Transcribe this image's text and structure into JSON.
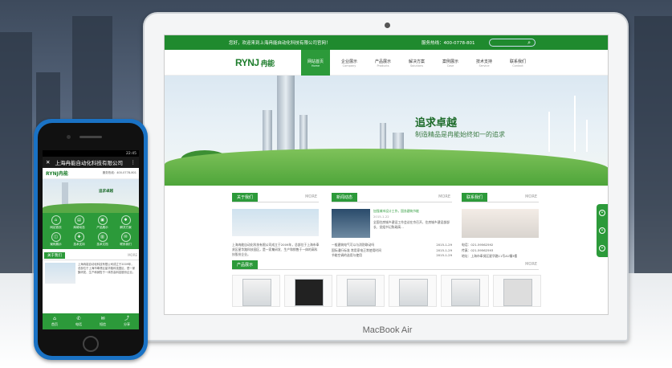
{
  "laptop_brand": "MacBook Air",
  "site": {
    "welcome": "您好，欢迎来到上海冉能自动化科技有限公司官网！",
    "hotline": "服务热线：400-0778-801",
    "logo_text": "RYNJ",
    "logo_cn": "冉能",
    "nav": [
      {
        "cn": "网站首页",
        "en": "Home",
        "active": true
      },
      {
        "cn": "企业展示",
        "en": "Company"
      },
      {
        "cn": "产品展示",
        "en": "Products"
      },
      {
        "cn": "解决方案",
        "en": "Solutions"
      },
      {
        "cn": "案例展示",
        "en": "Case"
      },
      {
        "cn": "技术支持",
        "en": "Service"
      },
      {
        "cn": "联系我们",
        "en": "Contact"
      }
    ],
    "slogan_main": "追求卓越",
    "slogan_sub": "制造精品是冉能始终如一的追求",
    "about": {
      "title": "关于我们",
      "more": "MORE",
      "text": "上海冉能自动化科技有限公司成立于2009年，总部位于上海市奉贤区星华路科技园区，是一家集研发、生产和销售于一体的高科技股份企业。"
    },
    "news": {
      "title": "新闻动态",
      "more": "MORE",
      "headline": "加强城市设计工作，国务建筑节能",
      "headline_date": "2015-1-22",
      "summary": "全国住房城乡建设工作会议在京召开，住房城乡建设部部长、党组书记陈政高…",
      "items": [
        {
          "text": "一般建筑电气可以与消防联动吗",
          "date": "2015-1-29"
        },
        {
          "text": "国际通行标准 常用家电正常使用时间",
          "date": "2015-1-29"
        },
        {
          "text": "节能空调的选用与使用",
          "date": "2015-1-29"
        }
      ]
    },
    "contact": {
      "title": "联系我们",
      "more": "MORE",
      "tel": "电话：021-59562592",
      "fax": "传真：021-59562593",
      "addr": "地址：上海市奉贤区星华路11号A1幢3楼"
    },
    "products": {
      "title": "产品展示",
      "more": "MORE"
    }
  },
  "mobile": {
    "time": "22:45",
    "title": "上海冉能自动化科技有限公司",
    "logo": "RYNJ冉能",
    "hotline": "服务热线：400-0778-801",
    "slogan": "追求卓越",
    "grid": [
      "网站首页",
      "商城动态",
      "产品展示",
      "解决方案",
      "案例展示",
      "技术支持",
      "技术文档",
      "联系我们"
    ],
    "about_title": "关于我们",
    "about_more": "MORE",
    "about_text": "上海冉能自动化科技有限公司成立于2009年，总部位于上海市奉贤区星华路科技园区，是一家集研发、生产和销售于一体的高科技股份企业。",
    "footer": [
      "首页",
      "电话",
      "短信",
      "分享"
    ]
  }
}
